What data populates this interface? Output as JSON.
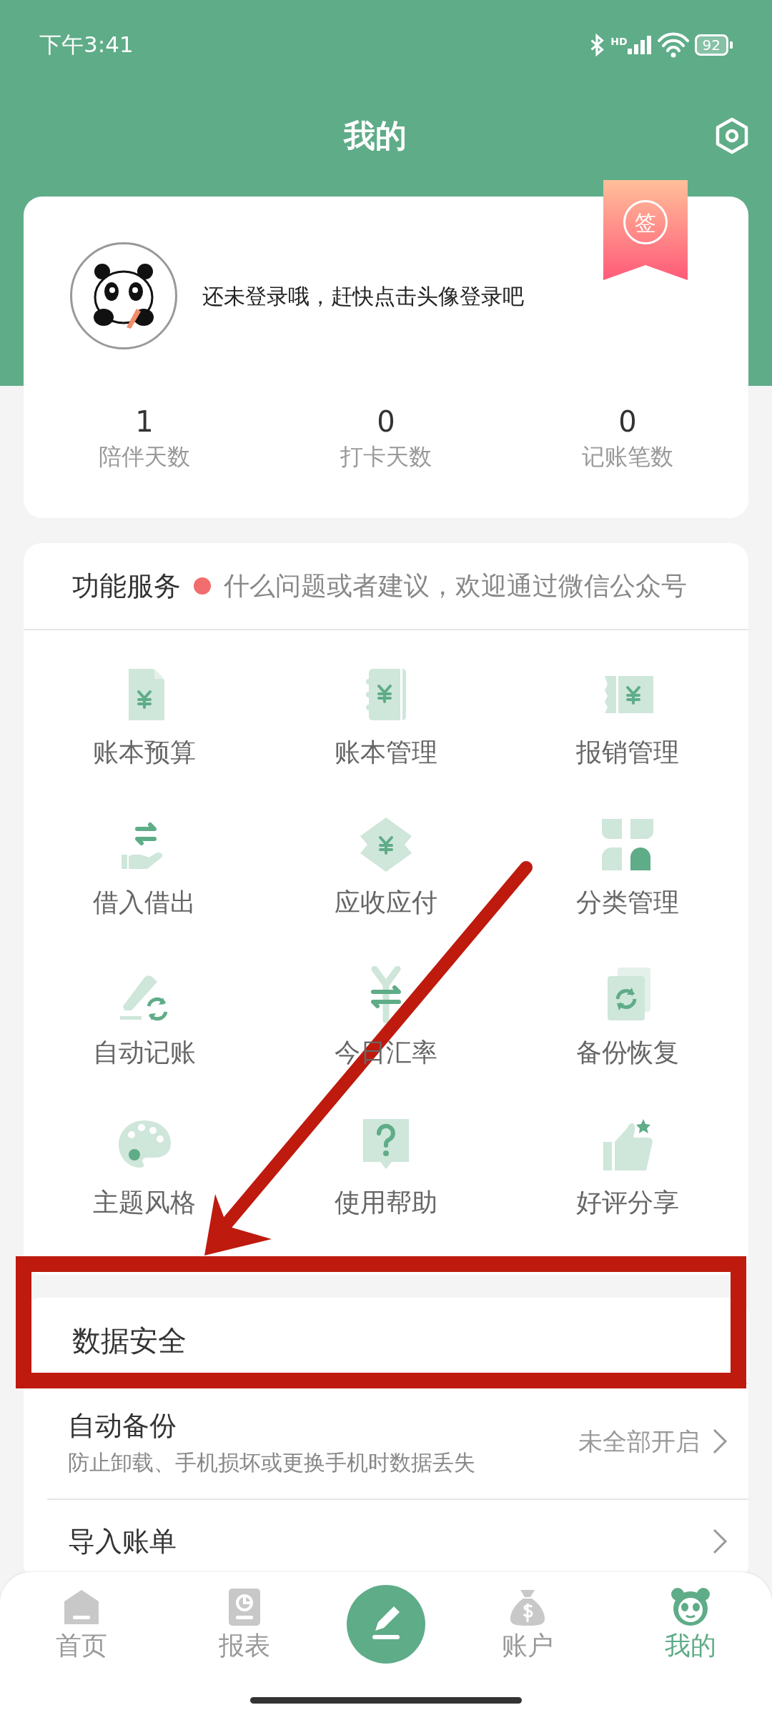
{
  "status_bar": {
    "time": "下午3:41",
    "network_label": "HD",
    "battery": "92"
  },
  "header": {
    "title": "我的"
  },
  "profile": {
    "prompt": "还未登录哦，赶快点击头像登录吧",
    "badge": "签",
    "stats": [
      {
        "value": "1",
        "label": "陪伴天数"
      },
      {
        "value": "0",
        "label": "打卡天数"
      },
      {
        "value": "0",
        "label": "记账笔数"
      }
    ]
  },
  "services": {
    "title": "功能服务",
    "notice": "什么问题或者建议，欢迎通过微信公众号",
    "items": [
      {
        "label": "账本预算"
      },
      {
        "label": "账本管理"
      },
      {
        "label": "报销管理"
      },
      {
        "label": "借入借出"
      },
      {
        "label": "应收应付"
      },
      {
        "label": "分类管理"
      },
      {
        "label": "自动记账"
      },
      {
        "label": "今日汇率"
      },
      {
        "label": "备份恢复"
      },
      {
        "label": "主题风格"
      },
      {
        "label": "使用帮助"
      },
      {
        "label": "好评分享"
      }
    ]
  },
  "data_security": {
    "title": "数据安全",
    "rows": [
      {
        "title": "自动备份",
        "subtitle": "防止卸载、手机损坏或更换手机时数据丢失",
        "value": "未全部开启"
      },
      {
        "title": "导入账单"
      }
    ]
  },
  "tab_bar": {
    "items": [
      {
        "label": "首页",
        "selected": false
      },
      {
        "label": "报表",
        "selected": false
      },
      {
        "kind": "compose"
      },
      {
        "label": "账户",
        "selected": false
      },
      {
        "label": "我的",
        "selected": true
      }
    ]
  }
}
